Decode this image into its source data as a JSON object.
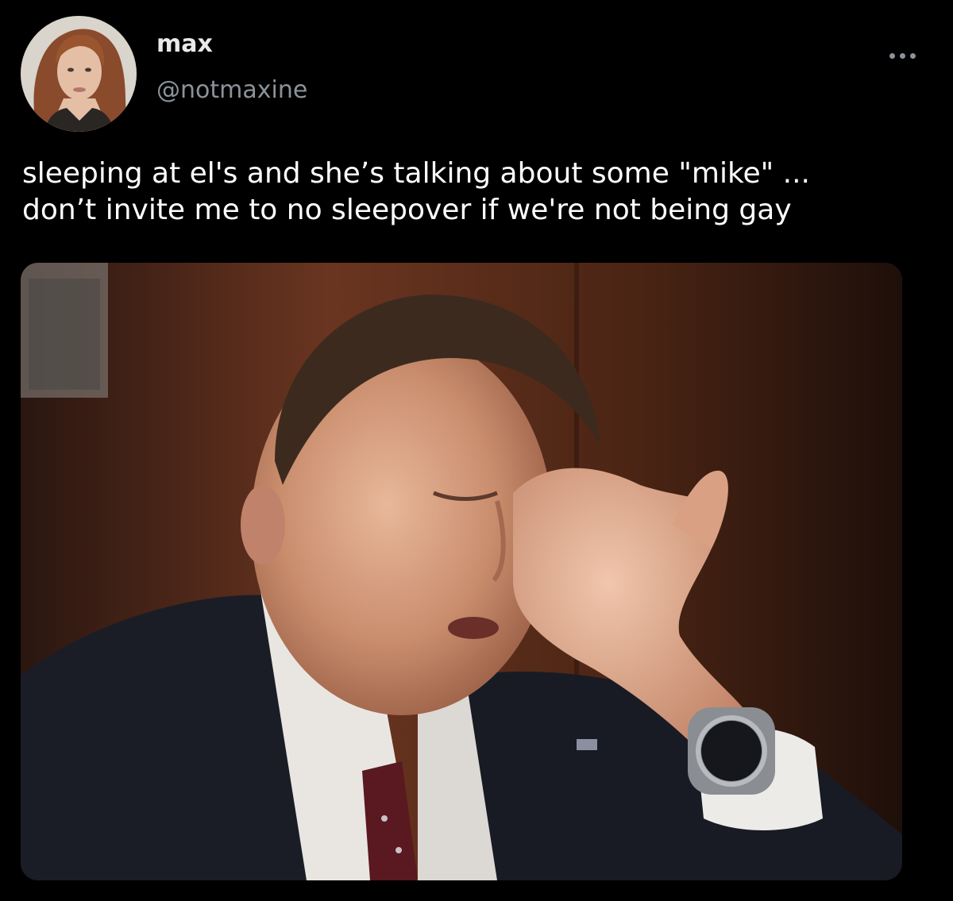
{
  "tweet": {
    "author": {
      "display_name": "max",
      "handle": "@notmaxine",
      "avatar_icon": "profile-photo"
    },
    "more_icon": "ellipsis-icon",
    "text_lines": [
      "sleeping at el's and she’s talking about some \"mike\" ...",
      "don’t invite me to no sleepover if we're not being gay"
    ],
    "media": {
      "kind": "photo"
    }
  },
  "colors": {
    "background": "#000000",
    "text_primary": "#ffffff",
    "text_secondary": "#8b9299"
  }
}
